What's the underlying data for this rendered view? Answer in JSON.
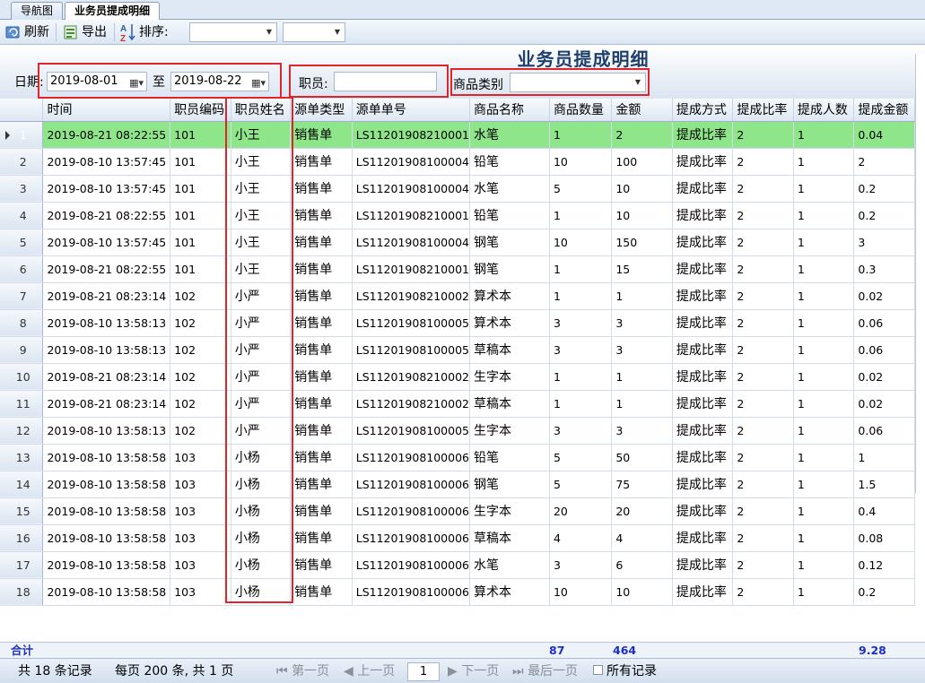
{
  "tabs": [
    {
      "label": "导航图"
    },
    {
      "label": "业务员提成明细"
    }
  ],
  "toolbar": {
    "refresh_label": "刷新",
    "export_label": "导出",
    "sort_label": "排序:",
    "sort_field": "",
    "sort_order": ""
  },
  "filter": {
    "title": "业务员提成明细",
    "date_label": "日期:",
    "date_from": "2019-08-01",
    "to_label": "至",
    "date_to": "2019-08-22",
    "staff_label": "职员:",
    "staff_value": "",
    "category_label": "商品类别",
    "category_value": ""
  },
  "grid": {
    "headers": [
      "时间",
      "职员编码",
      "职员姓名",
      "源单类型",
      "源单单号",
      "商品名称",
      "商品数量",
      "金额",
      "提成方式",
      "提成比率",
      "提成人数",
      "提成金额"
    ],
    "rows": [
      [
        "1",
        "2019-08-21 08:22:55",
        "101",
        "小王",
        "销售单",
        "LS11201908210001",
        "水笔",
        "1",
        "2",
        "提成比率",
        "2",
        "1",
        "0.04"
      ],
      [
        "2",
        "2019-08-10 13:57:45",
        "101",
        "小王",
        "销售单",
        "LS11201908100004",
        "铅笔",
        "10",
        "100",
        "提成比率",
        "2",
        "1",
        "2"
      ],
      [
        "3",
        "2019-08-10 13:57:45",
        "101",
        "小王",
        "销售单",
        "LS11201908100004",
        "水笔",
        "5",
        "10",
        "提成比率",
        "2",
        "1",
        "0.2"
      ],
      [
        "4",
        "2019-08-21 08:22:55",
        "101",
        "小王",
        "销售单",
        "LS11201908210001",
        "铅笔",
        "1",
        "10",
        "提成比率",
        "2",
        "1",
        "0.2"
      ],
      [
        "5",
        "2019-08-10 13:57:45",
        "101",
        "小王",
        "销售单",
        "LS11201908100004",
        "钢笔",
        "10",
        "150",
        "提成比率",
        "2",
        "1",
        "3"
      ],
      [
        "6",
        "2019-08-21 08:22:55",
        "101",
        "小王",
        "销售单",
        "LS11201908210001",
        "钢笔",
        "1",
        "15",
        "提成比率",
        "2",
        "1",
        "0.3"
      ],
      [
        "7",
        "2019-08-21 08:23:14",
        "102",
        "小严",
        "销售单",
        "LS11201908210002",
        "算术本",
        "1",
        "1",
        "提成比率",
        "2",
        "1",
        "0.02"
      ],
      [
        "8",
        "2019-08-10 13:58:13",
        "102",
        "小严",
        "销售单",
        "LS11201908100005",
        "算术本",
        "3",
        "3",
        "提成比率",
        "2",
        "1",
        "0.06"
      ],
      [
        "9",
        "2019-08-10 13:58:13",
        "102",
        "小严",
        "销售单",
        "LS11201908100005",
        "草稿本",
        "3",
        "3",
        "提成比率",
        "2",
        "1",
        "0.06"
      ],
      [
        "10",
        "2019-08-21 08:23:14",
        "102",
        "小严",
        "销售单",
        "LS11201908210002",
        "生字本",
        "1",
        "1",
        "提成比率",
        "2",
        "1",
        "0.02"
      ],
      [
        "11",
        "2019-08-21 08:23:14",
        "102",
        "小严",
        "销售单",
        "LS11201908210002",
        "草稿本",
        "1",
        "1",
        "提成比率",
        "2",
        "1",
        "0.02"
      ],
      [
        "12",
        "2019-08-10 13:58:13",
        "102",
        "小严",
        "销售单",
        "LS11201908100005",
        "生字本",
        "3",
        "3",
        "提成比率",
        "2",
        "1",
        "0.06"
      ],
      [
        "13",
        "2019-08-10 13:58:58",
        "103",
        "小杨",
        "销售单",
        "LS11201908100006",
        "铅笔",
        "5",
        "50",
        "提成比率",
        "2",
        "1",
        "1"
      ],
      [
        "14",
        "2019-08-10 13:58:58",
        "103",
        "小杨",
        "销售单",
        "LS11201908100006",
        "钢笔",
        "5",
        "75",
        "提成比率",
        "2",
        "1",
        "1.5"
      ],
      [
        "15",
        "2019-08-10 13:58:58",
        "103",
        "小杨",
        "销售单",
        "LS11201908100006",
        "生字本",
        "20",
        "20",
        "提成比率",
        "2",
        "1",
        "0.4"
      ],
      [
        "16",
        "2019-08-10 13:58:58",
        "103",
        "小杨",
        "销售单",
        "LS11201908100006",
        "草稿本",
        "4",
        "4",
        "提成比率",
        "2",
        "1",
        "0.08"
      ],
      [
        "17",
        "2019-08-10 13:58:58",
        "103",
        "小杨",
        "销售单",
        "LS11201908100006",
        "水笔",
        "3",
        "6",
        "提成比率",
        "2",
        "1",
        "0.12"
      ],
      [
        "18",
        "2019-08-10 13:58:58",
        "103",
        "小杨",
        "销售单",
        "LS11201908100006",
        "算术本",
        "10",
        "10",
        "提成比率",
        "2",
        "1",
        "0.2"
      ]
    ],
    "selected_row": 0,
    "selected_color": "#8fe58a"
  },
  "summary": {
    "label": "合计",
    "qty_total": "87",
    "amount_total": "464",
    "commission_total": "9.28"
  },
  "status": {
    "records_text": "共 18 条记录",
    "page_info_text": "每页 200 条, 共 1 页",
    "first_label": "第一页",
    "prev_label": "上一页",
    "page_value": "1",
    "next_label": "下一页",
    "last_label": "最后一页",
    "all_records_label": "所有记录"
  },
  "colors": {
    "highlight_red": "#e0242c",
    "accent_blue": "#1d2fc2"
  }
}
